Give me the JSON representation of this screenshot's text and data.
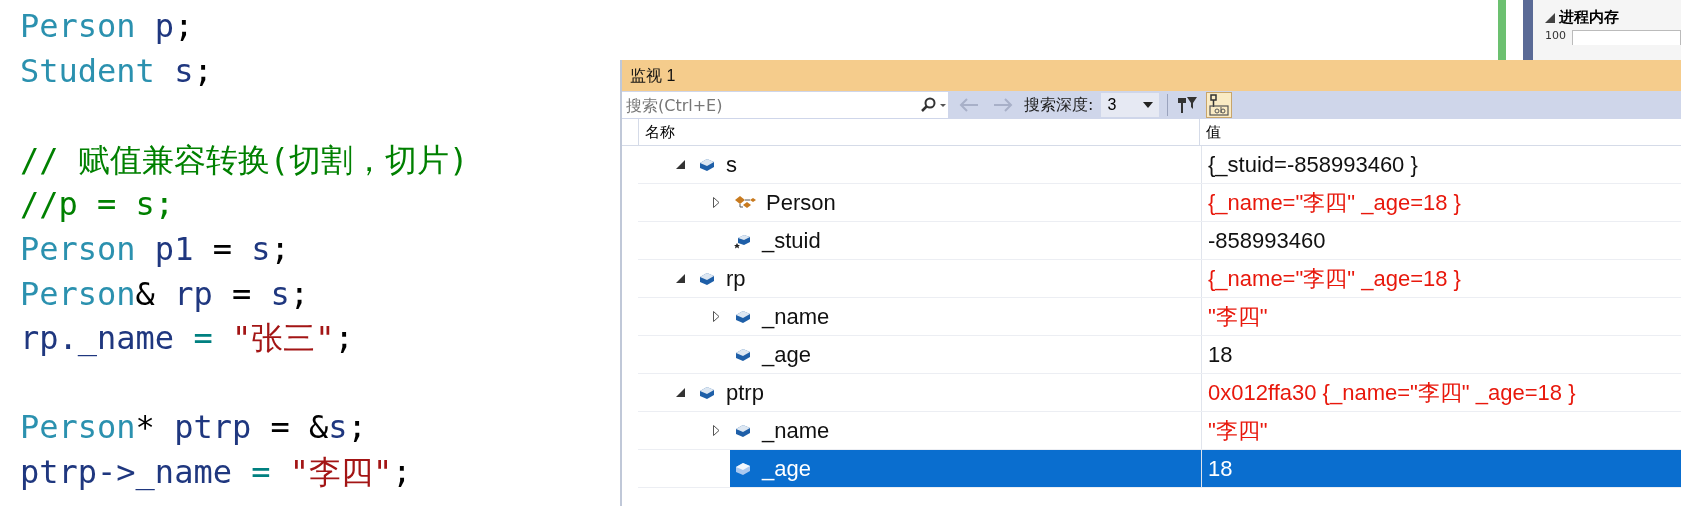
{
  "code": {
    "lines": [
      {
        "gap_before": false,
        "tokens": [
          {
            "text": "Person",
            "kind": "type"
          },
          {
            "text": " p",
            "kind": "ident"
          },
          {
            "text": ";",
            "kind": "punct"
          }
        ]
      },
      {
        "gap_before": false,
        "tokens": [
          {
            "text": "Student",
            "kind": "type"
          },
          {
            "text": " s",
            "kind": "ident"
          },
          {
            "text": ";",
            "kind": "punct"
          }
        ]
      },
      {
        "gap_before": true,
        "tokens": [
          {
            "text": "// 赋值兼容转换(切割，切片)",
            "kind": "comment"
          }
        ]
      },
      {
        "gap_before": false,
        "tokens": [
          {
            "text": "//p = s;",
            "kind": "comment"
          }
        ]
      },
      {
        "gap_before": false,
        "tokens": [
          {
            "text": "Person",
            "kind": "type"
          },
          {
            "text": " p1",
            "kind": "ident"
          },
          {
            "text": " = ",
            "kind": "punct"
          },
          {
            "text": "s",
            "kind": "ident"
          },
          {
            "text": ";",
            "kind": "punct"
          }
        ]
      },
      {
        "gap_before": false,
        "tokens": [
          {
            "text": "Person",
            "kind": "type"
          },
          {
            "text": "&",
            "kind": "punct"
          },
          {
            "text": " rp",
            "kind": "ident"
          },
          {
            "text": " = ",
            "kind": "punct"
          },
          {
            "text": "s",
            "kind": "ident"
          },
          {
            "text": ";",
            "kind": "punct"
          }
        ]
      },
      {
        "gap_before": false,
        "tokens": [
          {
            "text": "rp._name",
            "kind": "ident"
          },
          {
            "text": " = ",
            "kind": "op"
          },
          {
            "text": "\"张三\"",
            "kind": "string"
          },
          {
            "text": ";",
            "kind": "punct"
          }
        ]
      },
      {
        "gap_before": true,
        "tokens": [
          {
            "text": "Person",
            "kind": "type"
          },
          {
            "text": "*",
            "kind": "punct"
          },
          {
            "text": " ptrp",
            "kind": "ident"
          },
          {
            "text": " = &",
            "kind": "punct"
          },
          {
            "text": "s",
            "kind": "ident"
          },
          {
            "text": ";",
            "kind": "punct"
          }
        ]
      },
      {
        "gap_before": false,
        "tokens": [
          {
            "text": "ptrp->_name",
            "kind": "ident"
          },
          {
            "text": " = ",
            "kind": "op"
          },
          {
            "text": "\"李四\"",
            "kind": "string"
          },
          {
            "text": ";",
            "kind": "punct"
          }
        ]
      }
    ]
  },
  "side_panel": {
    "section": "进程内存",
    "axis_label": "100"
  },
  "watch": {
    "title": "监视 1",
    "search": {
      "placeholder": "搜索(Ctrl+E)"
    },
    "depth_label": "搜索深度:",
    "depth": "3",
    "back_disabled": true,
    "forward_disabled": true,
    "pin_toggled": true,
    "columns": [
      "名称",
      "值"
    ],
    "rows": [
      {
        "name": "s",
        "kind": "object",
        "expanded": true,
        "changed": false,
        "selected": false,
        "value": "{_stuid=-858993460 }",
        "children": [
          {
            "name": "Person",
            "kind": "base",
            "expanded": false,
            "changed": true,
            "selected": false,
            "value": "{_name=\"李四\" _age=18 }"
          },
          {
            "name": "_stuid",
            "kind": "private",
            "changed": false,
            "selected": false,
            "value": "-858993460"
          }
        ]
      },
      {
        "name": "rp",
        "kind": "object",
        "expanded": true,
        "changed": true,
        "selected": false,
        "value": "{_name=\"李四\" _age=18 }",
        "children": [
          {
            "name": "_name",
            "kind": "object",
            "expanded": false,
            "changed": true,
            "selected": false,
            "value": "\"李四\""
          },
          {
            "name": "_age",
            "kind": "object",
            "changed": false,
            "selected": false,
            "value": "18"
          }
        ]
      },
      {
        "name": "ptrp",
        "kind": "object",
        "expanded": true,
        "changed": true,
        "selected": false,
        "value": "0x012ffa30 {_name=\"李四\" _age=18 }",
        "children": [
          {
            "name": "_name",
            "kind": "object",
            "expanded": false,
            "changed": true,
            "selected": false,
            "value": "\"李四\""
          },
          {
            "name": "_age",
            "kind": "object",
            "changed": false,
            "selected": true,
            "value": "18"
          }
        ]
      }
    ]
  }
}
